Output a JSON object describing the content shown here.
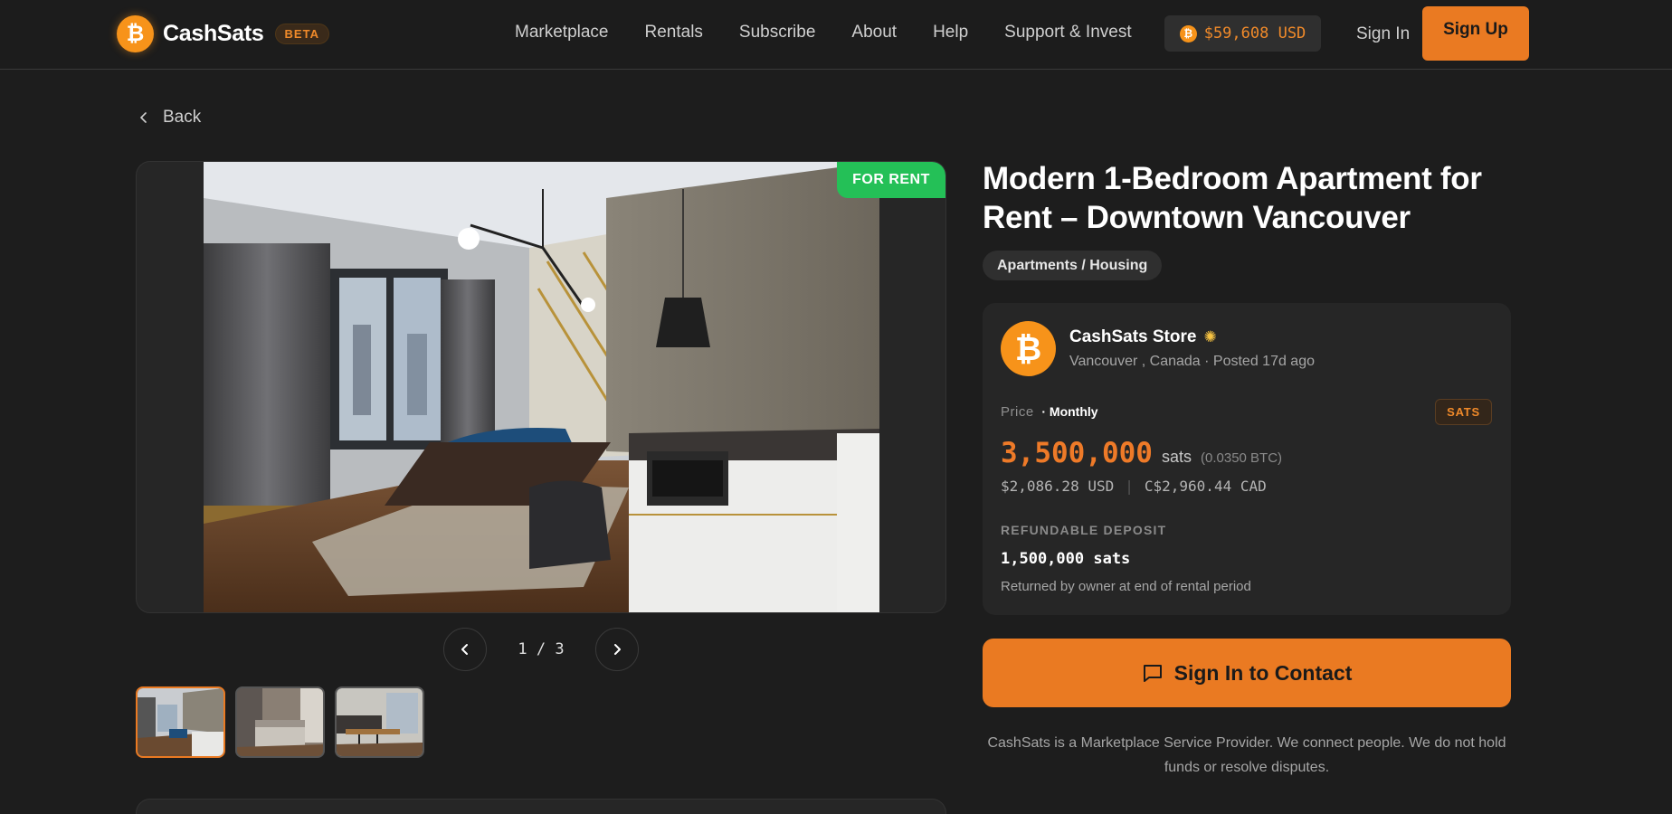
{
  "header": {
    "logo_text": "CashSats",
    "logo_icon": "bitcoin-icon",
    "badge": "BETA",
    "nav": [
      "Marketplace",
      "Rentals",
      "Subscribe",
      "About",
      "Help",
      "Support & Invest"
    ],
    "btc_price": "$59,608 USD",
    "sign_in": "Sign In",
    "sign_up": "Sign Up"
  },
  "back_label": "Back",
  "gallery": {
    "status_badge": "FOR RENT",
    "pager": "1 / 3",
    "current": 1,
    "total": 3,
    "thumbnails": [
      "living-room-kitchen",
      "bedroom",
      "kitchen-bar"
    ]
  },
  "listing": {
    "title": "Modern 1-Bedroom Apartment for Rent – Downtown Vancouver",
    "category": "Apartments / Housing",
    "seller": {
      "name": "CashSats Store",
      "verified_icon": "sun-badge-icon",
      "meta": "Vancouver , Canada · Posted 17d ago"
    },
    "price": {
      "label": "Price",
      "frequency": "· Monthly",
      "currency_badge": "SATS",
      "amount": "3,500,000",
      "unit": "sats",
      "btc": "(0.0350 BTC)",
      "usd": "$2,086.28 USD",
      "divider": "|",
      "cad": "C$2,960.44 CAD"
    },
    "deposit": {
      "label": "REFUNDABLE DEPOSIT",
      "amount": "1,500,000 sats",
      "note": "Returned by owner at end of rental period"
    },
    "contact_button": "Sign In to Contact",
    "disclaimer": "CashSats is a Marketplace Service Provider. We connect people. We do not hold funds or resolve disputes."
  },
  "colors": {
    "accent": "#ea7a22",
    "bitcoin": "#f7931a",
    "for_rent": "#24c057",
    "background": "#1d1d1d"
  }
}
